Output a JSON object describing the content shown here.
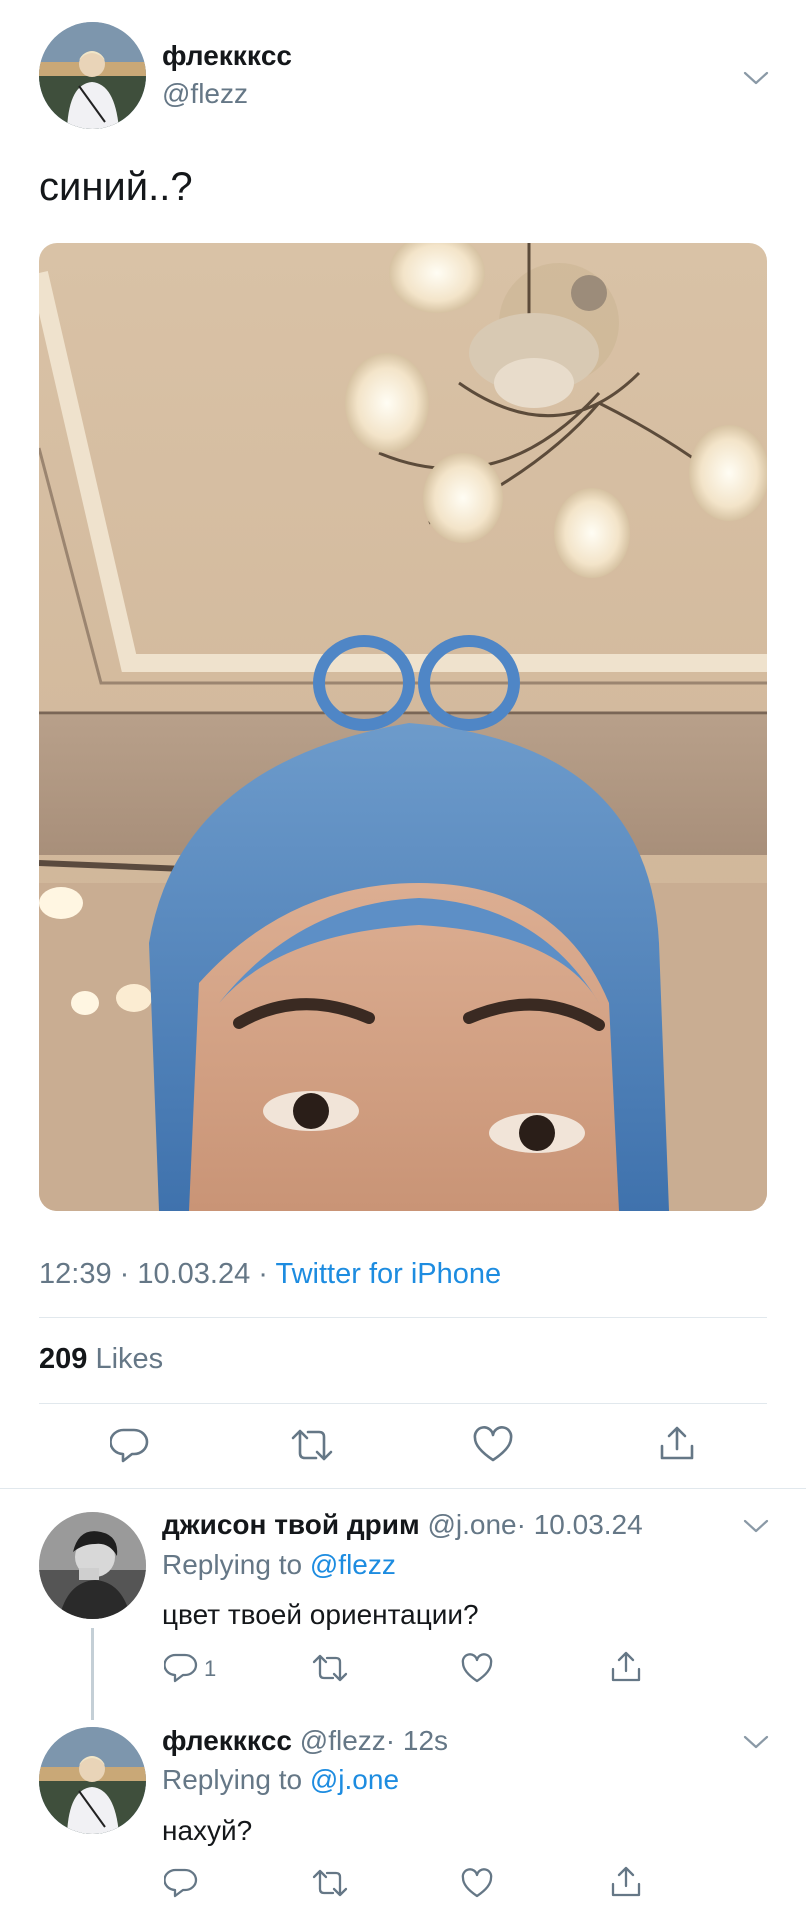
{
  "tweet": {
    "author_name": "флекккcс",
    "author_handle": "@flezz",
    "text": "синий..?",
    "time": "12:39 · 10.03.24 ·",
    "source": "Twitter for iPhone",
    "likes_count": "209",
    "likes_label": "Likes"
  },
  "replies": [
    {
      "name": "джисон твой дрим",
      "handle": "@j.one",
      "time": "· 10.03.24",
      "replying_prefix": "Replying to",
      "replying_to": "@flezz",
      "text": "цвет твоей ориентации?",
      "reply_count": "1"
    },
    {
      "name": "флекккcс",
      "handle": "@flezz",
      "time": "· 12s",
      "replying_prefix": "Replying to",
      "replying_to": "@j.one",
      "text": "нахуй?"
    }
  ],
  "colors": {
    "link": "#1d8ce0",
    "muted": "#657786",
    "hair": "#4f86c6"
  },
  "icons": [
    "reply-icon",
    "retweet-icon",
    "like-icon",
    "share-icon",
    "chevron-down-icon"
  ]
}
